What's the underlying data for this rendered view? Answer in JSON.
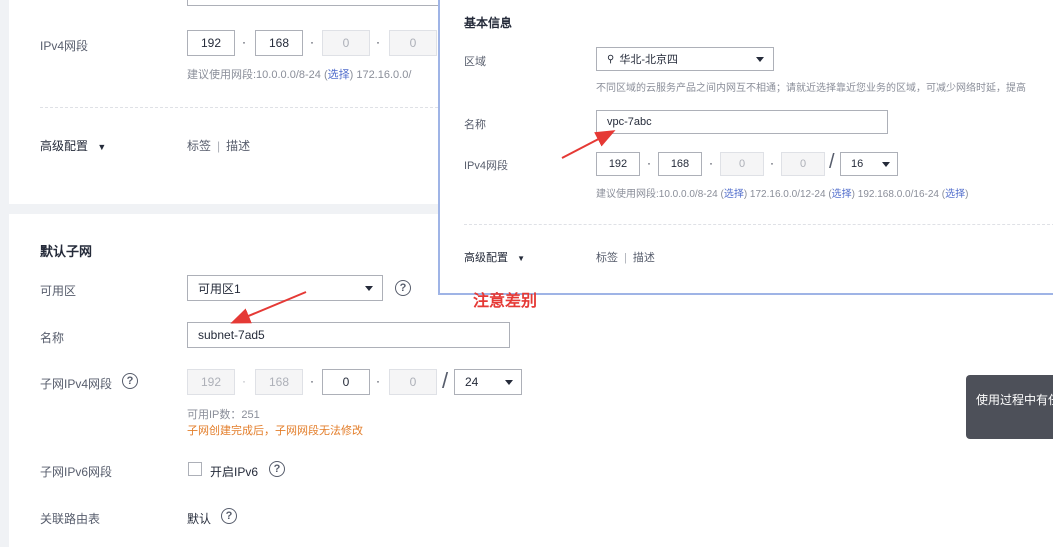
{
  "main": {
    "ipv4_label": "IPv4网段",
    "ipv4_octets": [
      "192",
      "168",
      "0",
      "0"
    ],
    "ipv4_hint_prefix": "建议使用网段:10.0.0.0/8-24 (",
    "ipv4_hint_link": "选择",
    "ipv4_hint_suffix": ")  172.16.0.0/",
    "advanced_label": "高级配置",
    "advanced_tags": "标签",
    "advanced_sep": "|",
    "advanced_desc": "描述"
  },
  "subnet": {
    "section_title": "默认子网",
    "az_label": "可用区",
    "az_value": "可用区1",
    "name_label": "名称",
    "name_value": "subnet-7ad5",
    "cidr_label": "子网IPv4网段",
    "cidr_octets": [
      "192",
      "168",
      "0",
      "0"
    ],
    "cidr_mask": "24",
    "cidr_slash": "/",
    "available_ip": "可用IP数：251",
    "cidr_warning": "子网创建完成后，子网网段无法修改",
    "ipv6_label": "子网IPv6网段",
    "ipv6_checkbox": "开启IPv6",
    "route_label": "关联路由表",
    "route_value": "默认"
  },
  "overlay": {
    "section_title": "基本信息",
    "region_label": "区域",
    "region_value": "华北-北京四",
    "region_hint": "不同区域的云服务产品之间内网互不相通；请就近选择靠近您业务的区域，可减少网络时延，提高",
    "name_label": "名称",
    "name_value": "vpc-7abc",
    "ipv4_label": "IPv4网段",
    "ipv4_octets": [
      "192",
      "168",
      "0",
      "0"
    ],
    "ipv4_mask": "16",
    "ipv4_slash": "/",
    "hint_1": "建议使用网段:10.0.0.0/8-24 (",
    "hint_link": "选择",
    "hint_2": ")  172.16.0.0/12-24 (",
    "hint_3": ")  192.168.0.0/16-24 (",
    "hint_4": ")",
    "advanced_label": "高级配置",
    "advanced_tags": "标签",
    "advanced_sep": "|",
    "advanced_desc": "描述"
  },
  "annotation": {
    "text": "注意差别",
    "color": "#e53935"
  },
  "toast": {
    "text": "使用过程中有任"
  },
  "colors": {
    "link": "#526ecc",
    "warning": "#e37d29",
    "arrow": "#e53935"
  }
}
